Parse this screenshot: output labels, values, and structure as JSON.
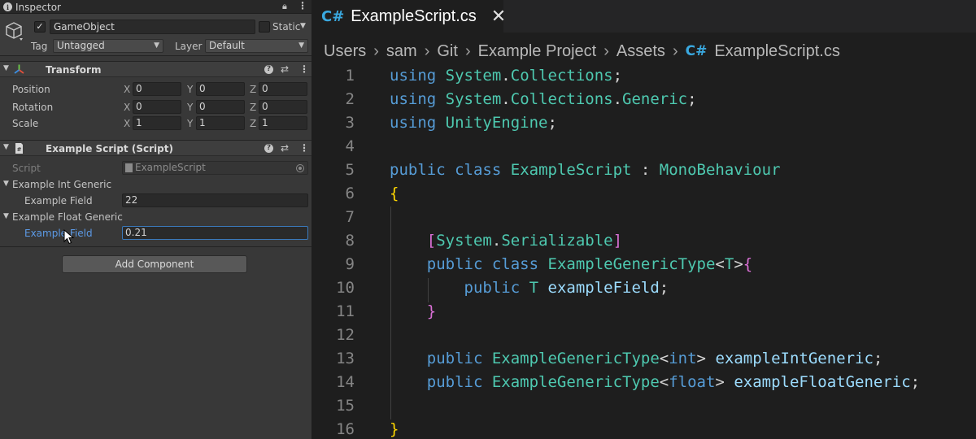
{
  "inspector": {
    "tab_label": "Inspector",
    "gameobject": {
      "active": true,
      "name": "GameObject",
      "static_label": "Static",
      "tag_label": "Tag",
      "tag_value": "Untagged",
      "layer_label": "Layer",
      "layer_value": "Default"
    },
    "transform": {
      "title": "Transform",
      "rows": [
        {
          "label": "Position",
          "x": "0",
          "y": "0",
          "z": "0"
        },
        {
          "label": "Rotation",
          "x": "0",
          "y": "0",
          "z": "0"
        },
        {
          "label": "Scale",
          "x": "1",
          "y": "1",
          "z": "1"
        }
      ],
      "axis": {
        "x": "X",
        "y": "Y",
        "z": "Z"
      }
    },
    "script_component": {
      "title": "Example Script (Script)",
      "script_label": "Script",
      "script_value": "ExampleScript",
      "int_generic_label": "Example Int Generic",
      "int_field_label": "Example Field",
      "int_field_value": "22",
      "float_generic_label": "Example Float Generic",
      "float_field_label": "Example Field",
      "float_field_value": "0.21"
    },
    "add_component_label": "Add Component"
  },
  "editor": {
    "tab_icon": "C#",
    "tab_title": "ExampleScript.cs",
    "breadcrumb": [
      "Users",
      "sam",
      "Git",
      "Example Project",
      "Assets",
      "ExampleScript.cs"
    ],
    "line_numbers": [
      "1",
      "2",
      "3",
      "4",
      "5",
      "6",
      "7",
      "8",
      "9",
      "10",
      "11",
      "12",
      "13",
      "14",
      "15",
      "16"
    ]
  },
  "colors": {
    "keyword": "#569cd6",
    "type": "#4ec9b0",
    "variable": "#9cdcfe",
    "bracket_gold": "#ffd700",
    "bracket_purple": "#da70d6",
    "focus_blue": "#3a79bb"
  }
}
